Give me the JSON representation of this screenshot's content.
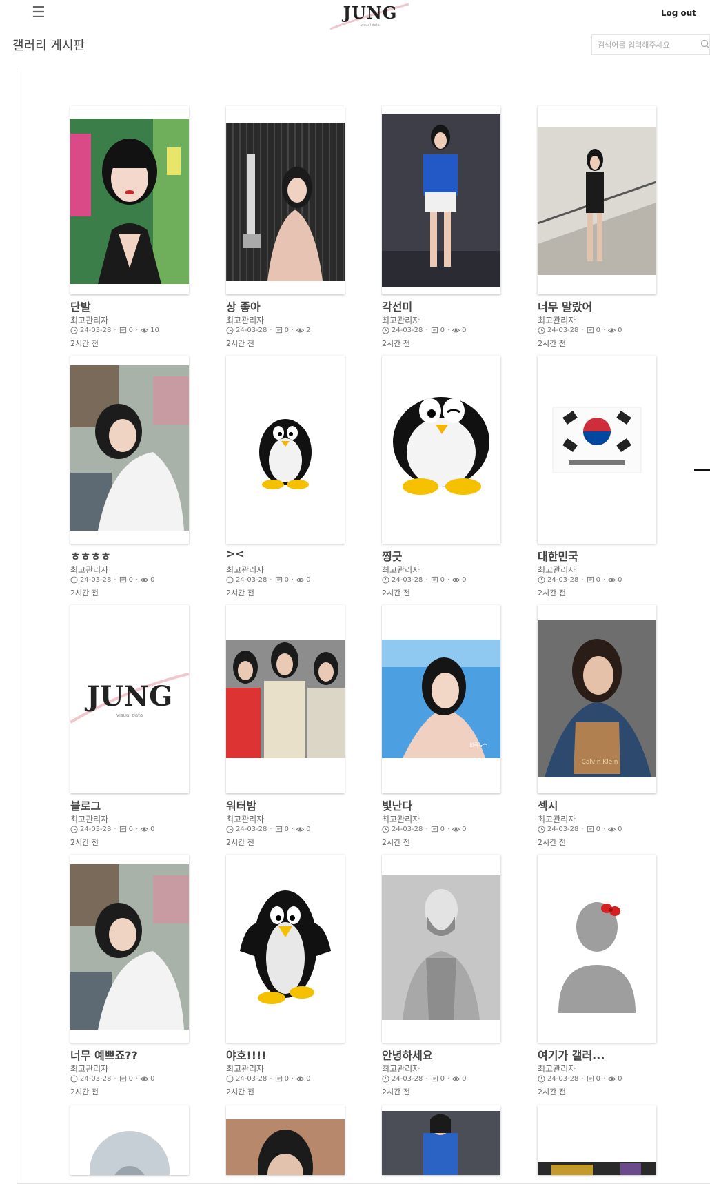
{
  "header": {
    "logo_text": "JUNG",
    "logo_sub": "visual data",
    "logout_label": "Log out"
  },
  "board": {
    "title": "갤러리 게시판",
    "search_placeholder": "검색어를 입력해주세요"
  },
  "posts": [
    {
      "title": "단발",
      "author": "최고관리자",
      "date": "24-03-28",
      "comments": "0",
      "views": "10",
      "ago": "2시간 전",
      "thumb": "portrait-bob-hair"
    },
    {
      "title": "상 좋아",
      "author": "최고관리자",
      "date": "24-03-28",
      "comments": "0",
      "views": "2",
      "ago": "2시간 전",
      "thumb": "woman-holding-trophy"
    },
    {
      "title": "각선미",
      "author": "최고관리자",
      "date": "24-03-28",
      "comments": "0",
      "views": "0",
      "ago": "2시간 전",
      "thumb": "stage-performer"
    },
    {
      "title": "너무 말랐어",
      "author": "최고관리자",
      "date": "24-03-28",
      "comments": "0",
      "views": "0",
      "ago": "2시간 전",
      "thumb": "woman-on-stairs"
    },
    {
      "title": "ㅎㅎㅎㅎ",
      "author": "최고관리자",
      "date": "24-03-28",
      "comments": "0",
      "views": "0",
      "ago": "2시간 전",
      "thumb": "woman-white-sweater"
    },
    {
      "title": "><",
      "author": "최고관리자",
      "date": "24-03-28",
      "comments": "0",
      "views": "0",
      "ago": "2시간 전",
      "thumb": "penguin-small"
    },
    {
      "title": "찡긋",
      "author": "최고관리자",
      "date": "24-03-28",
      "comments": "0",
      "views": "0",
      "ago": "2시간 전",
      "thumb": "penguin-winking"
    },
    {
      "title": "대한민국",
      "author": "최고관리자",
      "date": "24-03-28",
      "comments": "0",
      "views": "0",
      "ago": "2시간 전",
      "thumb": "korean-flag"
    },
    {
      "title": "블로그",
      "author": "최고관리자",
      "date": "24-03-28",
      "comments": "0",
      "views": "0",
      "ago": "2시간 전",
      "thumb": "jung-logo"
    },
    {
      "title": "워터밤",
      "author": "최고관리자",
      "date": "24-03-28",
      "comments": "0",
      "views": "0",
      "ago": "2시간 전",
      "thumb": "three-women"
    },
    {
      "title": "빛난다",
      "author": "최고관리자",
      "date": "24-03-28",
      "comments": "0",
      "views": "0",
      "ago": "2시간 전",
      "thumb": "woman-blue-background"
    },
    {
      "title": "섹시",
      "author": "최고관리자",
      "date": "24-03-28",
      "comments": "0",
      "views": "0",
      "ago": "2시간 전",
      "thumb": "woman-denim-jacket"
    },
    {
      "title": "너무 예쁘죠??",
      "author": "최고관리자",
      "date": "24-03-28",
      "comments": "0",
      "views": "0",
      "ago": "2시간 전",
      "thumb": "woman-white-sweater"
    },
    {
      "title": "야호!!!!",
      "author": "최고관리자",
      "date": "24-03-28",
      "comments": "0",
      "views": "0",
      "ago": "2시간 전",
      "thumb": "penguin-waving"
    },
    {
      "title": "안녕하세요",
      "author": "최고관리자",
      "date": "24-03-28",
      "comments": "0",
      "views": "0",
      "ago": "2시간 전",
      "thumb": "default-avatar-man"
    },
    {
      "title": "여기가 갤러...",
      "author": "최고관리자",
      "date": "24-03-28",
      "comments": "0",
      "views": "0",
      "ago": "2시간 전",
      "thumb": "default-avatar-bow"
    }
  ]
}
